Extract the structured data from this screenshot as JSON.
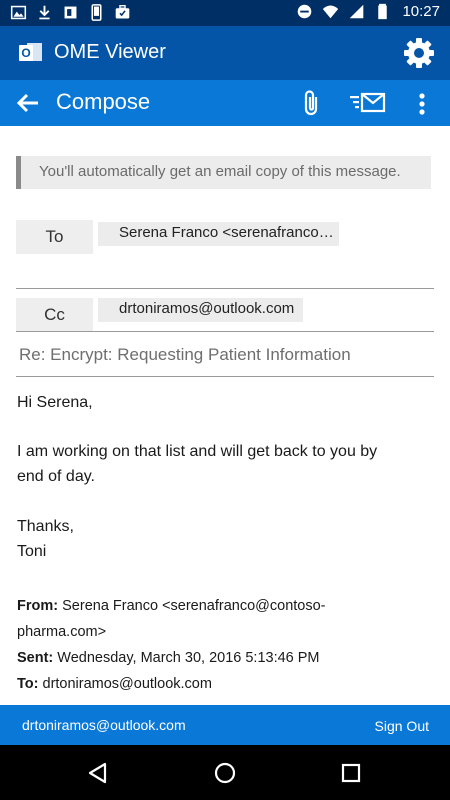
{
  "status_bar": {
    "time": "10:27",
    "left_icons": [
      "image-icon",
      "download-icon",
      "office-icon",
      "phone-icon",
      "briefcase-icon"
    ],
    "right_icons": [
      "do-not-disturb-icon",
      "wifi-icon",
      "signal-icon",
      "battery-icon"
    ]
  },
  "app_bar": {
    "title": "OME Viewer",
    "logo_icon": "outlook-logo-icon",
    "settings_icon": "gear-icon"
  },
  "compose_bar": {
    "title": "Compose",
    "back_icon": "arrow-left-icon",
    "attach_icon": "paperclip-icon",
    "send_icon": "send-mail-icon",
    "more_icon": "more-vert-icon"
  },
  "notice": "You'll automatically get an email copy of this message.",
  "to": {
    "label": "To",
    "recipient": "Serena Franco <serenafranco…"
  },
  "cc": {
    "label": "Cc",
    "recipient": "drtoniramos@outlook.com"
  },
  "subject": "Re: Encrypt: Requesting Patient Information",
  "body": {
    "greeting": "Hi Serena,",
    "line1": "I am working on that list and will get back to you by",
    "line2": "end of day.",
    "closing": "Thanks,",
    "signature": "Toni"
  },
  "quoted": {
    "from_label": "From:",
    "from_line1": "Serena Franco <serenafranco@contoso-",
    "from_line2": "pharma.com>",
    "sent_label": "Sent:",
    "sent_value": "Wednesday, March 30, 2016 5:13:46 PM",
    "to_label": "To:",
    "to_value": "drtoniramos@outlook.com"
  },
  "footer": {
    "email": "drtoniramos@outlook.com",
    "sign_out": "Sign Out"
  },
  "nav_bar": {
    "icons": [
      "back-triangle-icon",
      "home-circle-icon",
      "recents-square-icon"
    ]
  },
  "colors": {
    "status_bar": "#002f66",
    "app_bar": "#0455a8",
    "compose_bar": "#0a78d7",
    "footer": "#0a78d7"
  }
}
